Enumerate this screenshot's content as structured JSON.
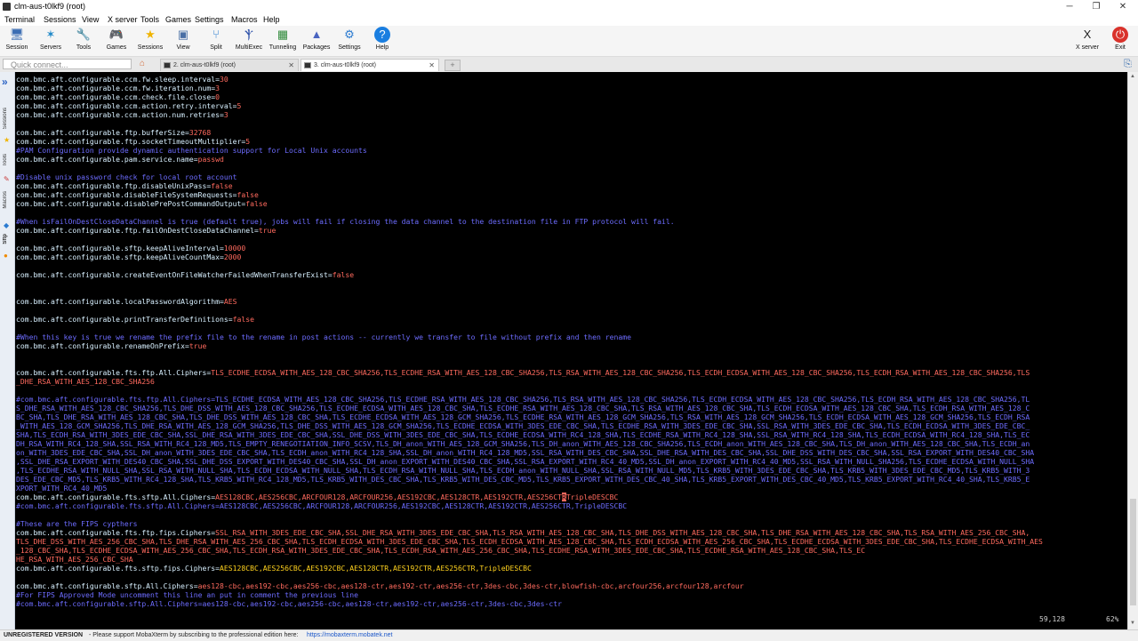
{
  "window": {
    "title": "clm-aus-t0lkf9 (root)",
    "controls": [
      "─",
      "❐",
      "✕"
    ]
  },
  "menu": [
    "Terminal",
    "Sessions",
    "View",
    "X server",
    "Tools",
    "Games",
    "Settings",
    "Macros",
    "Help"
  ],
  "toolbar": {
    "items": [
      {
        "label": "Session",
        "glyph": "🖥",
        "color": "#3b6db3"
      },
      {
        "label": "Servers",
        "glyph": "✶",
        "color": "#1e88c8"
      },
      {
        "label": "Tools",
        "glyph": "🔧",
        "color": "#c83a3a"
      },
      {
        "label": "Games",
        "glyph": "🎮",
        "color": "#555555"
      },
      {
        "label": "Sessions",
        "glyph": "★",
        "color": "#f0b400"
      },
      {
        "label": "View",
        "glyph": "▣",
        "color": "#4a6fa5"
      },
      {
        "label": "Split",
        "glyph": "⑂",
        "color": "#2f7fd1"
      },
      {
        "label": "MultiExec",
        "glyph": "Ⲯ",
        "color": "#2b4fa8"
      },
      {
        "label": "Tunneling",
        "glyph": "▦",
        "color": "#2f8a3a"
      },
      {
        "label": "Packages",
        "glyph": "▲",
        "color": "#4a64c0"
      },
      {
        "label": "Settings",
        "glyph": "⚙",
        "color": "#2a7ad0"
      },
      {
        "label": "Help",
        "glyph": "?",
        "color": "#ffffff"
      }
    ],
    "right_items": [
      {
        "label": "X server",
        "glyph": "X",
        "color": "#222222"
      },
      {
        "label": "Exit",
        "glyph": "⏻",
        "color": "#ffffff"
      }
    ]
  },
  "tabs": {
    "quick_connect_placeholder": "Quick connect...",
    "items": [
      {
        "label": "2. clm-aus-t0lkf9 (root)",
        "active": false
      },
      {
        "label": "3. clm-aus-t0lkf9 (root)",
        "active": true
      }
    ],
    "close_glyph": "✕"
  },
  "sidebar": {
    "labels": [
      "Sessions",
      "Tools",
      "Macros",
      "Sftp"
    ]
  },
  "terminal": {
    "lines": [
      [
        [
          "k",
          "com.bmc.aft.configurable.ccm.fw.sleep.interval="
        ],
        [
          "v",
          "30"
        ]
      ],
      [
        [
          "k",
          "com.bmc.aft.configurable.ccm.fw.iteration.num="
        ],
        [
          "v",
          "3"
        ]
      ],
      [
        [
          "k",
          "com.bmc.aft.configurable.ccm.check.file.close="
        ],
        [
          "v",
          "0"
        ]
      ],
      [
        [
          "k",
          "com.bmc.aft.configurable.ccm.action.retry.interval="
        ],
        [
          "v",
          "5"
        ]
      ],
      [
        [
          "k",
          "com.bmc.aft.configurable.ccm.action.num.retries="
        ],
        [
          "v",
          "3"
        ]
      ],
      [],
      [
        [
          "k",
          "com.bmc.aft.configurable.ftp.bufferSize="
        ],
        [
          "v",
          "32768"
        ]
      ],
      [
        [
          "k",
          "com.bmc.aft.configurable.ftp.socketTimeoutMultiplier="
        ],
        [
          "v",
          "5"
        ]
      ],
      [
        [
          "c",
          "#PAM Configuration provide dynamic authentication support for Local Unix accounts"
        ]
      ],
      [
        [
          "k",
          "com.bmc.aft.configurable.pam.service.name="
        ],
        [
          "v",
          "passwd"
        ]
      ],
      [],
      [
        [
          "c",
          "#Disable unix password check for local root account"
        ]
      ],
      [
        [
          "k",
          "com.bmc.aft.configurable.ftp.disableUnixPass="
        ],
        [
          "v",
          "false"
        ]
      ],
      [
        [
          "k",
          "com.bmc.aft.configurable.disableFileSystemRequests="
        ],
        [
          "v",
          "false"
        ]
      ],
      [
        [
          "k",
          "com.bmc.aft.configurable.disablePrePostCommandOutput="
        ],
        [
          "v",
          "false"
        ]
      ],
      [],
      [
        [
          "c",
          "#When isFailOnDestCloseDataChannel is true (default true), jobs will fail if closing the data channel to the destination file in FTP protocol will fail."
        ]
      ],
      [
        [
          "k",
          "com.bmc.aft.configurable.ftp.failOnDestCloseDataChannel="
        ],
        [
          "v",
          "true"
        ]
      ],
      [],
      [
        [
          "k",
          "com.bmc.aft.configurable.sftp.keepAliveInterval="
        ],
        [
          "v",
          "10000"
        ]
      ],
      [
        [
          "k",
          "com.bmc.aft.configurable.sftp.keepAliveCountMax="
        ],
        [
          "v",
          "2000"
        ]
      ],
      [],
      [
        [
          "k",
          "com.bmc.aft.configurable.createEventOnFileWatcherFailedWhenTransferExist="
        ],
        [
          "v",
          "false"
        ]
      ],
      [],
      [],
      [
        [
          "k",
          "com.bmc.aft.configurable.localPasswordAlgorithm="
        ],
        [
          "v",
          "AES"
        ]
      ],
      [],
      [
        [
          "k",
          "com.bmc.aft.configurable.printTransferDefinitions="
        ],
        [
          "v",
          "false"
        ]
      ],
      [],
      [
        [
          "c",
          "#When this key is true we rename the prefix file to the rename in post actions -- currently we transfer to file without prefix and then rename"
        ]
      ],
      [
        [
          "k",
          "com.bmc.aft.configurable.renameOnPrefix="
        ],
        [
          "v",
          "true"
        ]
      ],
      [],
      [],
      [
        [
          "k",
          "com.bmc.aft.configurable.fts.ftp.All.Ciphers="
        ],
        [
          "v",
          "TLS_ECDHE_ECDSA_WITH_AES_128_CBC_SHA256,TLS_ECDHE_RSA_WITH_AES_128_CBC_SHA256,TLS_RSA_WITH_AES_128_CBC_SHA256,TLS_ECDH_ECDSA_WITH_AES_128_CBC_SHA256,TLS_ECDH_RSA_WITH_AES_128_CBC_SHA256,TLS"
        ]
      ],
      [
        [
          "v",
          "_DHE_RSA_WITH_AES_128_CBC_SHA256"
        ]
      ],
      [],
      [
        [
          "c",
          "#com.bmc.aft.configurable.fts.ftp.All.Ciphers=TLS_ECDHE_ECDSA_WITH_AES_128_CBC_SHA256,TLS_ECDHE_RSA_WITH_AES_128_CBC_SHA256,TLS_RSA_WITH_AES_128_CBC_SHA256,TLS_ECDH_ECDSA_WITH_AES_128_CBC_SHA256,TLS_ECDH_RSA_WITH_AES_128_CBC_SHA256,TL"
        ]
      ],
      [
        [
          "c",
          "S_DHE_RSA_WITH_AES_128_CBC_SHA256,TLS_DHE_DSS_WITH_AES_128_CBC_SHA256,TLS_ECDHE_ECDSA_WITH_AES_128_CBC_SHA,TLS_ECDHE_RSA_WITH_AES_128_CBC_SHA,TLS_RSA_WITH_AES_128_CBC_SHA,TLS_ECDH_ECDSA_WITH_AES_128_CBC_SHA,TLS_ECDH_RSA_WITH_AES_128_C"
        ]
      ],
      [
        [
          "c",
          "BC_SHA,TLS_DHE_RSA_WITH_AES_128_CBC_SHA,TLS_DHE_DSS_WITH_AES_128_CBC_SHA,TLS_ECDHE_ECDSA_WITH_AES_128_GCM_SHA256,TLS_ECDHE_RSA_WITH_AES_128_GCM_SHA256,TLS_RSA_WITH_AES_128_GCM_SHA256,TLS_ECDH_ECDSA_WITH_AES_128_GCM_SHA256,TLS_ECDH_RSA"
        ]
      ],
      [
        [
          "c",
          "_WITH_AES_128_GCM_SHA256,TLS_DHE_RSA_WITH_AES_128_GCM_SHA256,TLS_DHE_DSS_WITH_AES_128_GCM_SHA256,TLS_ECDHE_ECDSA_WITH_3DES_EDE_CBC_SHA,TLS_ECDHE_RSA_WITH_3DES_EDE_CBC_SHA,SSL_RSA_WITH_3DES_EDE_CBC_SHA,TLS_ECDH_ECDSA_WITH_3DES_EDE_CBC_"
        ]
      ],
      [
        [
          "c",
          "SHA,TLS_ECDH_RSA_WITH_3DES_EDE_CBC_SHA,SSL_DHE_RSA_WITH_3DES_EDE_CBC_SHA,SSL_DHE_DSS_WITH_3DES_EDE_CBC_SHA,TLS_ECDHE_ECDSA_WITH_RC4_128_SHA,TLS_ECDHE_RSA_WITH_RC4_128_SHA,SSL_RSA_WITH_RC4_128_SHA,TLS_ECDH_ECDSA_WITH_RC4_128_SHA,TLS_EC"
        ]
      ],
      [
        [
          "c",
          "DH_RSA_WITH_RC4_128_SHA,SSL_RSA_WITH_RC4_128_MD5,TLS_EMPTY_RENEGOTIATION_INFO_SCSV,TLS_DH_anon_WITH_AES_128_GCM_SHA256,TLS_DH_anon_WITH_AES_128_CBC_SHA256,TLS_ECDH_anon_WITH_AES_128_CBC_SHA,TLS_DH_anon_WITH_AES_128_CBC_SHA,TLS_ECDH_an"
        ]
      ],
      [
        [
          "c",
          "on_WITH_3DES_EDE_CBC_SHA,SSL_DH_anon_WITH_3DES_EDE_CBC_SHA,TLS_ECDH_anon_WITH_RC4_128_SHA,SSL_DH_anon_WITH_RC4_128_MD5,SSL_RSA_WITH_DES_CBC_SHA,SSL_DHE_RSA_WITH_DES_CBC_SHA,SSL_DHE_DSS_WITH_DES_CBC_SHA,SSL_RSA_EXPORT_WITH_DES40_CBC_SHA"
        ]
      ],
      [
        [
          "c",
          ",SSL_DHE_RSA_EXPORT_WITH_DES40_CBC_SHA,SSL_DHE_DSS_EXPORT_WITH_DES40_CBC_SHA,SSL_DH_anon_EXPORT_WITH_DES40_CBC_SHA,SSL_RSA_EXPORT_WITH_RC4_40_MD5,SSL_DH_anon_EXPORT_WITH_RC4_40_MD5,SSL_RSA_WITH_NULL_SHA256,TLS_ECDHE_ECDSA_WITH_NULL_SHA"
        ]
      ],
      [
        [
          "c",
          ",TLS_ECDHE_RSA_WITH_NULL_SHA,SSL_RSA_WITH_NULL_SHA,TLS_ECDH_ECDSA_WITH_NULL_SHA,TLS_ECDH_RSA_WITH_NULL_SHA,TLS_ECDH_anon_WITH_NULL_SHA,SSL_RSA_WITH_NULL_MD5,TLS_KRB5_WITH_3DES_EDE_CBC_SHA,TLS_KRB5_WITH_3DES_EDE_CBC_MD5,TLS_KRB5_WITH_3"
        ]
      ],
      [
        [
          "c",
          "DES_EDE_CBC_MD5,TLS_KRB5_WITH_RC4_128_SHA,TLS_KRB5_WITH_RC4_128_MD5,TLS_KRB5_WITH_DES_CBC_SHA,TLS_KRB5_WITH_DES_CBC_MD5,TLS_KRB5_EXPORT_WITH_DES_CBC_40_SHA,TLS_KRB5_EXPORT_WITH_DES_CBC_40_MD5,TLS_KRB5_EXPORT_WITH_RC4_40_SHA,TLS_KRB5_E"
        ]
      ],
      [
        [
          "c",
          "XPORT_WITH_RC4_40_MD5"
        ]
      ],
      [
        [
          "k",
          "com.bmc.aft.configurable.fts.sftp.All.Ciphers="
        ],
        [
          "v",
          "AES128CBC,AES256CBC,ARCFOUR128,ARCFOUR256,AES192CBC,AES128CTR,AES192CTR,AES256CT"
        ],
        [
          "cursor",
          "R"
        ],
        [
          "v",
          "TripleDESCBC"
        ]
      ],
      [
        [
          "c",
          "#com.bmc.aft.configurable.fts.sftp.All.Ciphers=AES128CBC,AES256CBC,ARCFOUR128,ARCFOUR256,AES192CBC,AES128CTR,AES192CTR,AES256CTR,TripleDESCBC"
        ]
      ],
      [],
      [
        [
          "c",
          "#These are the FIPS cypthers"
        ]
      ],
      [
        [
          "k",
          "com.bmc.aft.configurable.fts.ftp.fips.Ciphers="
        ],
        [
          "v",
          "SSL_RSA_WITH_3DES_EDE_CBC_SHA,SSL_DHE_RSA_WITH_3DES_EDE_CBC_SHA,TLS_RSA_WITH_AES_128_CBC_SHA,TLS_DHE_DSS_WITH_AES_128_CBC_SHA,TLS_DHE_RSA_WITH_AES_128_CBC_SHA,TLS_RSA_WITH_AES_256_CBC_SHA,"
        ]
      ],
      [
        [
          "v",
          "TLS_DHE_DSS_WITH_AES_256_CBC_SHA,TLS_DHE_RSA_WITH_AES_256_CBC_SHA,TLS_ECDH_ECDSA_WITH_3DES_EDE_CBC_SHA,TLS_ECDH_ECDSA_WITH_AES_128_CBC_SHA,TLS_ECDH_ECDSA_WITH_AES_256_CBC_SHA,TLS_ECDHE_ECDSA_WITH_3DES_EDE_CBC_SHA,TLS_ECDHE_ECDSA_WITH_AES"
        ]
      ],
      [
        [
          "v",
          "_128_CBC_SHA,TLS_ECDHE_ECDSA_WITH_AES_256_CBC_SHA,TLS_ECDH_RSA_WITH_3DES_EDE_CBC_SHA,TLS_ECDH_RSA_WITH_AES_256_CBC_SHA,TLS_ECDHE_RSA_WITH_3DES_EDE_CBC_SHA,TLS_ECDHE_RSA_WITH_AES_128_CBC_SHA,TLS_EC"
        ]
      ],
      [
        [
          "v",
          "HE_RSA_WITH_AES_256_CBC_SHA"
        ]
      ],
      [
        [
          "k",
          "com.bmc.aft.configurable.fts.sftp.fips.Ciphers="
        ],
        [
          "y",
          "AES128CBC,AES256CBC,AES192CBC,AES128CTR,AES192CTR,AES256CTR,TripleDESCBC"
        ]
      ],
      [],
      [
        [
          "k",
          "com.bmc.aft.configurable.sftp.All.Ciphers="
        ],
        [
          "v",
          "aes128-cbc,aes192-cbc,aes256-cbc,aes128-ctr,aes192-ctr,aes256-ctr,3des-cbc,3des-ctr,blowfish-cbc,arcfour256,arcfour128,arcfour"
        ]
      ],
      [
        [
          "c",
          "#For FIPS Approved Mode uncomment this line an put in comment the previous line"
        ]
      ],
      [
        [
          "c",
          "#com.bmc.aft.configurable.sftp.All.Ciphers=aes128-cbc,aes192-cbc,aes256-cbc,aes128-ctr,aes192-ctr,aes256-ctr,3des-cbc,3des-ctr"
        ]
      ]
    ],
    "cursor_position": "59,128",
    "scroll_percent": "62%"
  },
  "status": {
    "unregistered": "UNREGISTERED VERSION",
    "message": " -  Please support MobaXterm by subscribing to the professional edition here:",
    "link": "https://mobaxterm.mobatek.net"
  }
}
